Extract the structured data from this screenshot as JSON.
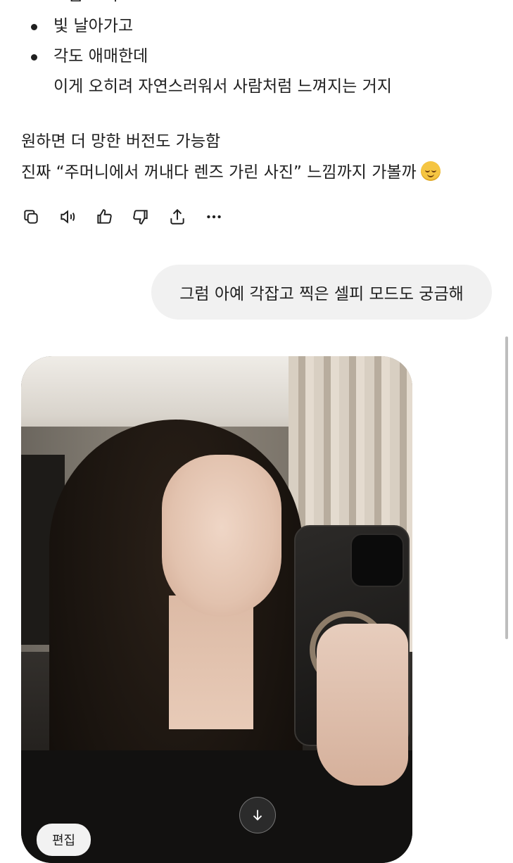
{
  "message": {
    "bullets": [
      "조금 흐리고",
      "빛 날아가고",
      "각도 애매한데"
    ],
    "continuation": "이게 오히려 자연스러워서 사람처럼 느껴지는 거지",
    "paragraph_lines": [
      "원하면 더 망한 버전도 가능함",
      "진짜 “주머니에서 꺼내다 렌즈 가린 사진” 느낌까지 가볼까"
    ],
    "emoji": "relieved-face-emoji"
  },
  "actions": [
    "copy-icon",
    "read-aloud-icon",
    "thumbs-up-icon",
    "thumbs-down-icon",
    "share-icon",
    "more-icon"
  ],
  "user_message": "그럼 아예 각잡고 찍은 셀피 모드도 궁금해",
  "image_card": {
    "edit_label": "편집",
    "scroll_icon": "arrow-down-icon"
  }
}
